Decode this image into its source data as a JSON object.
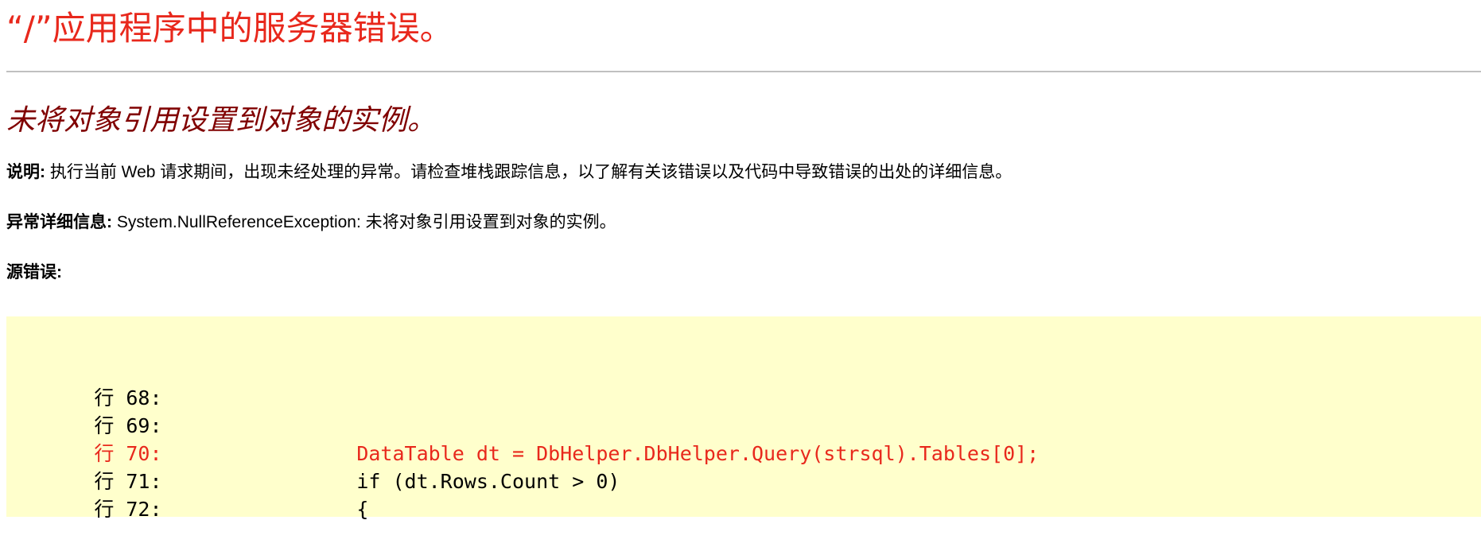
{
  "page_title": "“/”应用程序中的服务器错误。",
  "error_message": "未将对象引用设置到对象的实例。",
  "description": {
    "label": "说明:",
    "text": "执行当前 Web 请求期间，出现未经处理的异常。请检查堆栈跟踪信息，以了解有关该错误以及代码中导致错误的出处的详细信息。"
  },
  "exception_details": {
    "label": "异常详细信息:",
    "text": "System.NullReferenceException: 未将对象引用设置到对象的实例。"
  },
  "source_error": {
    "label": "源错误:"
  },
  "code_lines": [
    {
      "line_label": "行 68:",
      "code": "",
      "highlighted": false
    },
    {
      "line_label": "行 69:",
      "code": "",
      "highlighted": false
    },
    {
      "line_label": "行 70:",
      "code": "DataTable dt = DbHelper.DbHelper.Query(strsql).Tables[0];",
      "highlighted": true
    },
    {
      "line_label": "行 71:",
      "code": "if (dt.Rows.Count > 0)",
      "highlighted": false
    },
    {
      "line_label": "行 72:",
      "code": "{",
      "highlighted": false
    }
  ],
  "colors": {
    "title": "#e8281c",
    "error_message": "#800000",
    "highlight_line": "#e8281c",
    "code_background": "#ffffcc",
    "rule": "#c0c0c0"
  }
}
